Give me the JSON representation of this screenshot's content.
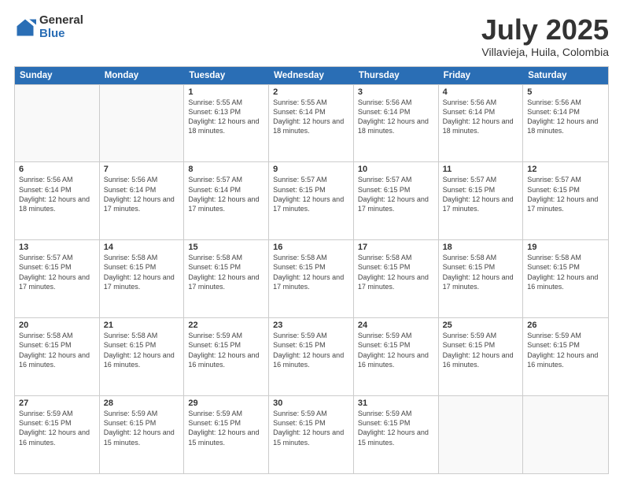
{
  "logo": {
    "general": "General",
    "blue": "Blue"
  },
  "title": {
    "month": "July 2025",
    "location": "Villavieja, Huila, Colombia"
  },
  "days": [
    "Sunday",
    "Monday",
    "Tuesday",
    "Wednesday",
    "Thursday",
    "Friday",
    "Saturday"
  ],
  "weeks": [
    [
      {
        "date": "",
        "sunrise": "",
        "sunset": "",
        "daylight": ""
      },
      {
        "date": "",
        "sunrise": "",
        "sunset": "",
        "daylight": ""
      },
      {
        "date": "1",
        "sunrise": "Sunrise: 5:55 AM",
        "sunset": "Sunset: 6:13 PM",
        "daylight": "Daylight: 12 hours and 18 minutes."
      },
      {
        "date": "2",
        "sunrise": "Sunrise: 5:55 AM",
        "sunset": "Sunset: 6:14 PM",
        "daylight": "Daylight: 12 hours and 18 minutes."
      },
      {
        "date": "3",
        "sunrise": "Sunrise: 5:56 AM",
        "sunset": "Sunset: 6:14 PM",
        "daylight": "Daylight: 12 hours and 18 minutes."
      },
      {
        "date": "4",
        "sunrise": "Sunrise: 5:56 AM",
        "sunset": "Sunset: 6:14 PM",
        "daylight": "Daylight: 12 hours and 18 minutes."
      },
      {
        "date": "5",
        "sunrise": "Sunrise: 5:56 AM",
        "sunset": "Sunset: 6:14 PM",
        "daylight": "Daylight: 12 hours and 18 minutes."
      }
    ],
    [
      {
        "date": "6",
        "sunrise": "Sunrise: 5:56 AM",
        "sunset": "Sunset: 6:14 PM",
        "daylight": "Daylight: 12 hours and 18 minutes."
      },
      {
        "date": "7",
        "sunrise": "Sunrise: 5:56 AM",
        "sunset": "Sunset: 6:14 PM",
        "daylight": "Daylight: 12 hours and 17 minutes."
      },
      {
        "date": "8",
        "sunrise": "Sunrise: 5:57 AM",
        "sunset": "Sunset: 6:14 PM",
        "daylight": "Daylight: 12 hours and 17 minutes."
      },
      {
        "date": "9",
        "sunrise": "Sunrise: 5:57 AM",
        "sunset": "Sunset: 6:15 PM",
        "daylight": "Daylight: 12 hours and 17 minutes."
      },
      {
        "date": "10",
        "sunrise": "Sunrise: 5:57 AM",
        "sunset": "Sunset: 6:15 PM",
        "daylight": "Daylight: 12 hours and 17 minutes."
      },
      {
        "date": "11",
        "sunrise": "Sunrise: 5:57 AM",
        "sunset": "Sunset: 6:15 PM",
        "daylight": "Daylight: 12 hours and 17 minutes."
      },
      {
        "date": "12",
        "sunrise": "Sunrise: 5:57 AM",
        "sunset": "Sunset: 6:15 PM",
        "daylight": "Daylight: 12 hours and 17 minutes."
      }
    ],
    [
      {
        "date": "13",
        "sunrise": "Sunrise: 5:57 AM",
        "sunset": "Sunset: 6:15 PM",
        "daylight": "Daylight: 12 hours and 17 minutes."
      },
      {
        "date": "14",
        "sunrise": "Sunrise: 5:58 AM",
        "sunset": "Sunset: 6:15 PM",
        "daylight": "Daylight: 12 hours and 17 minutes."
      },
      {
        "date": "15",
        "sunrise": "Sunrise: 5:58 AM",
        "sunset": "Sunset: 6:15 PM",
        "daylight": "Daylight: 12 hours and 17 minutes."
      },
      {
        "date": "16",
        "sunrise": "Sunrise: 5:58 AM",
        "sunset": "Sunset: 6:15 PM",
        "daylight": "Daylight: 12 hours and 17 minutes."
      },
      {
        "date": "17",
        "sunrise": "Sunrise: 5:58 AM",
        "sunset": "Sunset: 6:15 PM",
        "daylight": "Daylight: 12 hours and 17 minutes."
      },
      {
        "date": "18",
        "sunrise": "Sunrise: 5:58 AM",
        "sunset": "Sunset: 6:15 PM",
        "daylight": "Daylight: 12 hours and 17 minutes."
      },
      {
        "date": "19",
        "sunrise": "Sunrise: 5:58 AM",
        "sunset": "Sunset: 6:15 PM",
        "daylight": "Daylight: 12 hours and 16 minutes."
      }
    ],
    [
      {
        "date": "20",
        "sunrise": "Sunrise: 5:58 AM",
        "sunset": "Sunset: 6:15 PM",
        "daylight": "Daylight: 12 hours and 16 minutes."
      },
      {
        "date": "21",
        "sunrise": "Sunrise: 5:58 AM",
        "sunset": "Sunset: 6:15 PM",
        "daylight": "Daylight: 12 hours and 16 minutes."
      },
      {
        "date": "22",
        "sunrise": "Sunrise: 5:59 AM",
        "sunset": "Sunset: 6:15 PM",
        "daylight": "Daylight: 12 hours and 16 minutes."
      },
      {
        "date": "23",
        "sunrise": "Sunrise: 5:59 AM",
        "sunset": "Sunset: 6:15 PM",
        "daylight": "Daylight: 12 hours and 16 minutes."
      },
      {
        "date": "24",
        "sunrise": "Sunrise: 5:59 AM",
        "sunset": "Sunset: 6:15 PM",
        "daylight": "Daylight: 12 hours and 16 minutes."
      },
      {
        "date": "25",
        "sunrise": "Sunrise: 5:59 AM",
        "sunset": "Sunset: 6:15 PM",
        "daylight": "Daylight: 12 hours and 16 minutes."
      },
      {
        "date": "26",
        "sunrise": "Sunrise: 5:59 AM",
        "sunset": "Sunset: 6:15 PM",
        "daylight": "Daylight: 12 hours and 16 minutes."
      }
    ],
    [
      {
        "date": "27",
        "sunrise": "Sunrise: 5:59 AM",
        "sunset": "Sunset: 6:15 PM",
        "daylight": "Daylight: 12 hours and 16 minutes."
      },
      {
        "date": "28",
        "sunrise": "Sunrise: 5:59 AM",
        "sunset": "Sunset: 6:15 PM",
        "daylight": "Daylight: 12 hours and 15 minutes."
      },
      {
        "date": "29",
        "sunrise": "Sunrise: 5:59 AM",
        "sunset": "Sunset: 6:15 PM",
        "daylight": "Daylight: 12 hours and 15 minutes."
      },
      {
        "date": "30",
        "sunrise": "Sunrise: 5:59 AM",
        "sunset": "Sunset: 6:15 PM",
        "daylight": "Daylight: 12 hours and 15 minutes."
      },
      {
        "date": "31",
        "sunrise": "Sunrise: 5:59 AM",
        "sunset": "Sunset: 6:15 PM",
        "daylight": "Daylight: 12 hours and 15 minutes."
      },
      {
        "date": "",
        "sunrise": "",
        "sunset": "",
        "daylight": ""
      },
      {
        "date": "",
        "sunrise": "",
        "sunset": "",
        "daylight": ""
      }
    ]
  ]
}
